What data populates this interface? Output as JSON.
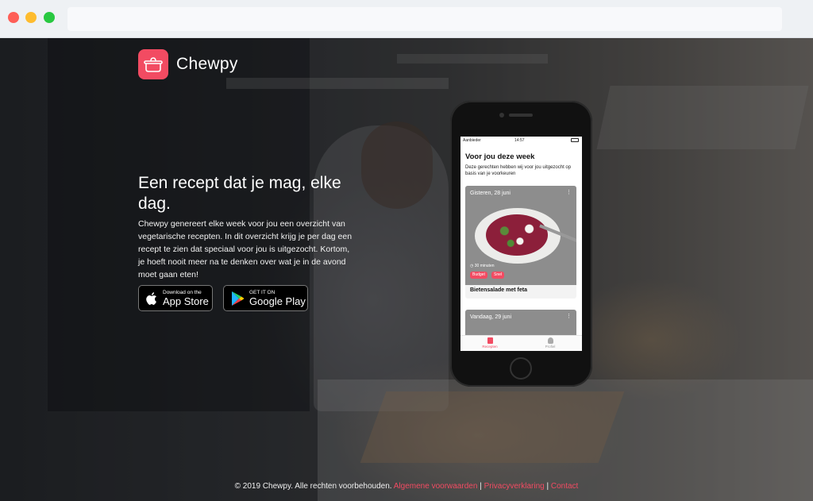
{
  "brand": {
    "name": "Chewpy",
    "icon": "pot-icon",
    "accent": "#f24b62"
  },
  "hero": {
    "headline": "Een recept dat je mag, elke dag.",
    "body": "Chewpy genereert elke week voor jou een overzicht van vegetarische recepten. In dit overzicht krijg je per dag een recept te zien dat speciaal voor jou is uitgezocht. Kortom, je hoeft nooit meer na te denken over wat je in de avond moet gaan eten!"
  },
  "badges": {
    "apple": {
      "small": "Download on the",
      "big": "App Store",
      "icon": "apple-icon"
    },
    "google": {
      "small": "GET IT ON",
      "big": "Google Play",
      "icon": "google-play-icon"
    }
  },
  "phone": {
    "status": {
      "carrier": "Aanbieder",
      "time": "14:57"
    },
    "title": "Voor jou deze week",
    "subtitle": "Deze gerechten hebben wij voor jou uitgezocht op basis van je voorkeuren",
    "cards": [
      {
        "date": "Gisteren, 28 juni",
        "time": "30 minuten",
        "tags": [
          "Budget",
          "Snel"
        ],
        "name": "Bietensalade met feta"
      },
      {
        "date": "Vandaag, 29 juni"
      }
    ],
    "tabs": [
      {
        "label": "Recepten"
      },
      {
        "label": "Profiel"
      }
    ]
  },
  "footer": {
    "copyright": "© 2019 Chewpy. Alle rechten voorbehouden.",
    "links": [
      "Algemene voorwaarden",
      "Privacyverklaring",
      "Contact"
    ],
    "separator": "|"
  }
}
